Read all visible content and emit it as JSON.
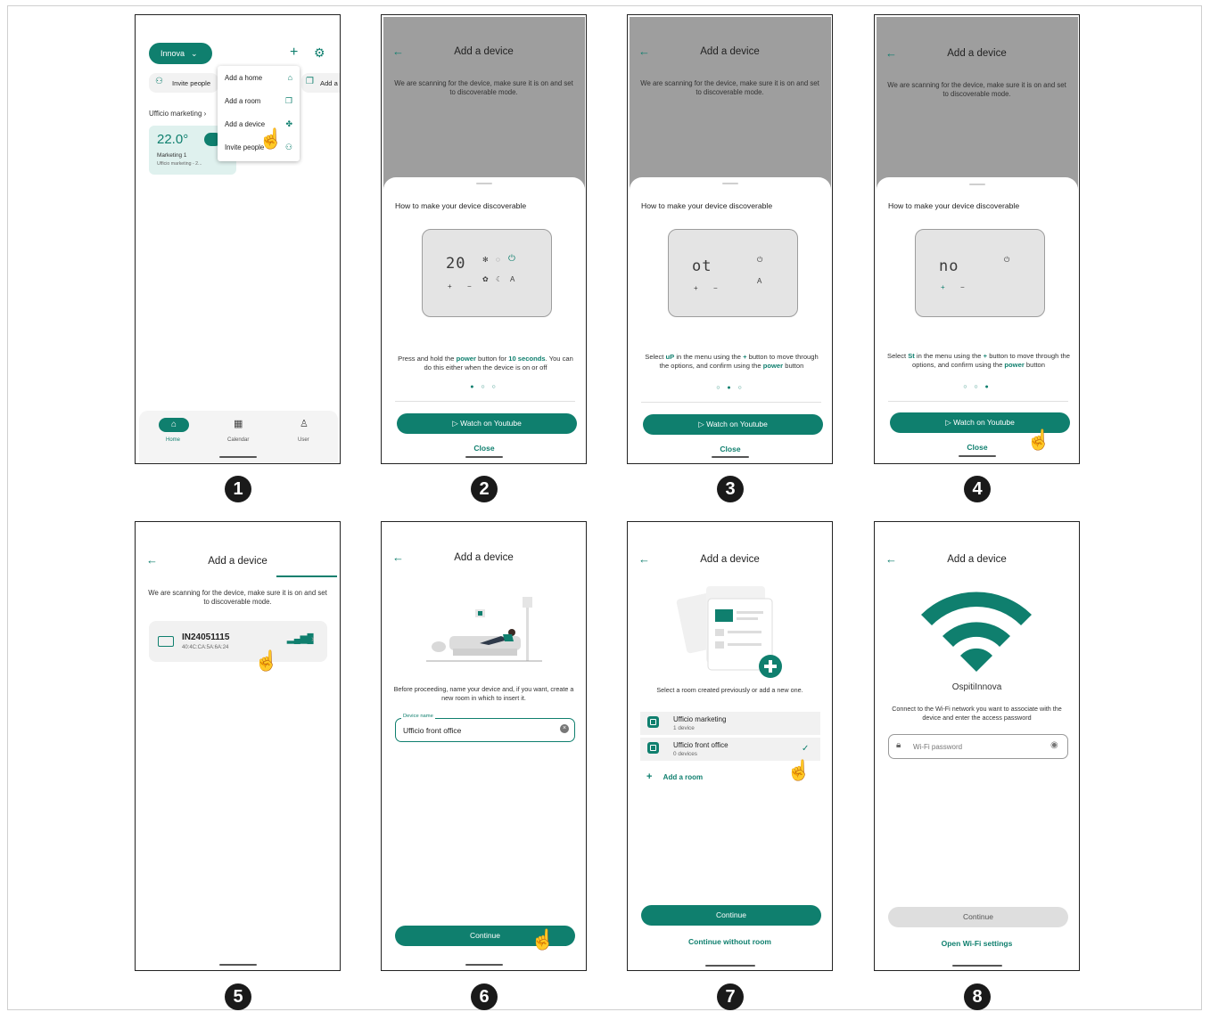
{
  "steps": [
    "1",
    "2",
    "3",
    "4",
    "5",
    "6",
    "7",
    "8"
  ],
  "s1": {
    "home_button": "Innova",
    "plus": "+",
    "invite_people": "Invite people",
    "add_short": "Add a",
    "section": "Ufficio marketing",
    "temp": "22.0°",
    "card_title": "Marketing 1",
    "card_sub": "Ufficio marketing - 2...",
    "menu": [
      "Add a home",
      "Add a room",
      "Add a device",
      "Invite people"
    ],
    "nav": [
      "Home",
      "Calendar",
      "User"
    ]
  },
  "common": {
    "back": "←",
    "title": "Add a device",
    "scanning": "We are scanning for the device, make sure it is on and set to discoverable mode.",
    "sheet_title": "How to make your device discoverable",
    "watch": "Watch on Youtube",
    "close": "Close"
  },
  "s2": {
    "display": "20",
    "plus": "+",
    "minus": "−",
    "a": "A",
    "instr_pre": "Press and hold the ",
    "instr_power": "power",
    "instr_mid": " button for ",
    "instr_secs": "10 seconds",
    "instr_post": ". You can do this either when the device is on or off",
    "dots": "● ○ ○"
  },
  "s3": {
    "display": "ot",
    "plus": "+",
    "minus": "−",
    "a": "A",
    "instr_a": "Select ",
    "instr_code": "uP",
    "instr_b": " in the menu using the ",
    "instr_plus": "+",
    "instr_c": " button to move through the options, and confirm using the ",
    "instr_power": "power",
    "instr_d": " button",
    "dots": "○ ● ○"
  },
  "s4": {
    "display": "no",
    "plus": "+",
    "minus": "−",
    "instr_a": "Select ",
    "instr_code": "St",
    "instr_b": " in the menu using the ",
    "instr_plus": "+",
    "instr_c": " button to move through the options, and confirm using the ",
    "instr_power": "power",
    "instr_d": " button",
    "dots": "○ ○ ●"
  },
  "s5": {
    "device_name": "IN24051115",
    "device_mac": "40:4C:CA:5A:6A:24"
  },
  "s6": {
    "helper": "Before proceeding, name your device and, if you want, create a new room in which to insert it.",
    "field_label": "Device name",
    "field_value": "Ufficio front office",
    "continue": "Continue"
  },
  "s7": {
    "helper": "Select a room created previously or add a new one.",
    "rooms": [
      {
        "name": "Ufficio marketing",
        "sub": "1 device"
      },
      {
        "name": "Ufficio front office",
        "sub": "0 devices"
      }
    ],
    "add_room": "Add a room",
    "continue": "Continue",
    "continue_without": "Continue without room"
  },
  "s8": {
    "network": "OspitiInnova",
    "helper": "Connect to the Wi-Fi network you want to associate with the device and enter the access password",
    "password_placeholder": "Wi-Fi password",
    "continue": "Continue",
    "open_settings": "Open Wi-Fi settings"
  },
  "colors": {
    "accent": "#0f7f6e",
    "grey_bg": "#9e9e9e"
  },
  "icons": [
    "settings-icon",
    "home-icon",
    "room-icon",
    "device-icon",
    "invite-icon",
    "calendar-icon",
    "user-icon",
    "youtube-icon",
    "power-icon",
    "wifi-icon",
    "signal-icon",
    "lock-icon",
    "eye-icon",
    "check-icon",
    "clear-icon",
    "hand-cursor-icon"
  ]
}
